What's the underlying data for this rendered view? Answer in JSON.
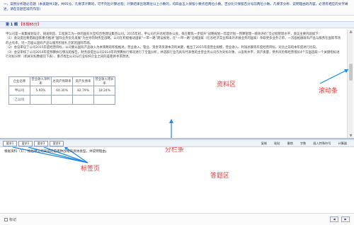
{
  "header": {
    "text": "一、案例分析题必答题（本类题共1题，共65分。凡要求计算的，可不列出计算过程；计算结果出现两位以上小数的，均四舍五入保留小数点后两位小数。百分比只保留百分号前两位小数。凡要求分析、说明理由的内容，必须有相应的文字阐述。请在答题区域内作答）"
  },
  "question_bar": {
    "number": "第 1 题",
    "tag": "【本题65分】"
  },
  "material": {
    "intro": "甲公司是一家集规划设计、研发制造、工程施工为一体的国有大型综合性建设集团公司。2015年初，甲公司召开总经理办公会，拟在聚焦一步提升“战略规划—年度计划—预算管理—绩效评价”全过程管理水平，会议主要内容如下：",
    "p1": "（1）会议提出要借助国家重点推进“国际业务优先发展”为主导的财务型战略。公司在积极推动国家“一带一路”建设规划，在“一带一路”沿线国家（在总经济实业和未外开展业务的国家）争取更多业务订单，一方面拓展既有产品与服务在国际市场的占有率，另一方面以国有产品与服务积极扎企新的国际市场。",
    "p2": "（2）会议审议了公司2015年度经营目标，公司要以国有产品收入为本策略的积极推进，营业收入，管业、资金等资源本次的关键，推出了2015年度营业规模，营业收入、利润总额等年度经营目标，对比之前的本年度进行比较。",
    "p3": "（3）会议审核了公司2014年度预算执行情况的报告，财务部提出公司2014年的预算执行情况进行了全面分析，并选取行业内具有代表性的主营业务公司作为对标对象，以盈利水平，资产质量，债务风险和经营增长4个方面选取一个关键指标进行对标分析（相关对标数据见下表），重点找出公司与行业标杆企业之间的差距并寻求改进。",
    "table_headers": [
      "企业名称",
      "营业收入净利率",
      "总资产周转率",
      "资产负债率",
      "营业收入增长率"
    ],
    "table_row1": [
      "甲公司",
      "5.93%",
      "60.30%",
      "82.79%",
      "18.24%"
    ],
    "table_row2": [
      "乙公司",
      "",
      "",
      "",
      ""
    ]
  },
  "labels": {
    "material_area": "资料区",
    "scrollbar": "滚动条",
    "tab_pages": "标签页",
    "splitter": "分栏条",
    "answer_area": "答题区"
  },
  "tabs": [
    "要求1",
    "要求2",
    "要求3",
    "要求4"
  ],
  "tools": [
    "复制",
    "粘贴",
    "撤销",
    "字数",
    "插入特殊符号",
    "计算器"
  ],
  "answer": {
    "prompt": "根据资料（1），指出甲公司采取的是哪种战略的具体类型，并说明理由。"
  },
  "footer": {
    "mark_label": "标记"
  },
  "colors": {
    "label_red": "#e53935",
    "header_blue": "#1f3b8a"
  }
}
